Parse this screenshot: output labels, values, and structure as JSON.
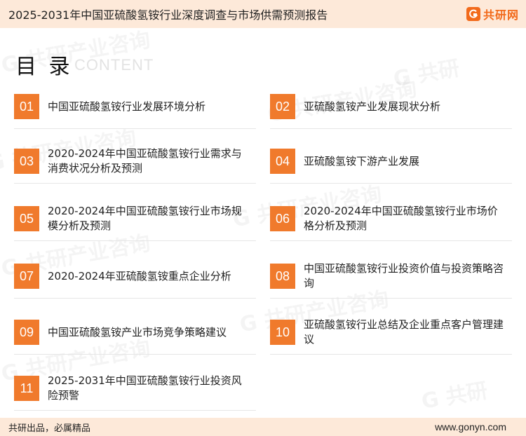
{
  "header": {
    "title": "2025-2031年中国亚硫酸氢铵行业深度调查与市场供需预测报告",
    "logo_text": "共研网"
  },
  "toc": {
    "title": "目 录",
    "subtitle": "CONTENT"
  },
  "items": [
    {
      "num": "01",
      "label": "中国亚硫酸氢铵行业发展环境分析"
    },
    {
      "num": "02",
      "label": "亚硫酸氢铵产业发展现状分析"
    },
    {
      "num": "03",
      "label": "2020-2024年中国亚硫酸氢铵行业需求与消费状况分析及预测"
    },
    {
      "num": "04",
      "label": "亚硫酸氢铵下游产业发展"
    },
    {
      "num": "05",
      "label": "2020-2024年中国亚硫酸氢铵行业市场规模分析及预测"
    },
    {
      "num": "06",
      "label": "2020-2024年中国亚硫酸氢铵行业市场价格分析及预测"
    },
    {
      "num": "07",
      "label": "2020-2024年亚硫酸氢铵重点企业分析"
    },
    {
      "num": "08",
      "label": "中国亚硫酸氢铵行业投资价值与投资策略咨询"
    },
    {
      "num": "09",
      "label": "中国亚硫酸氢铵产业市场竞争策略建议"
    },
    {
      "num": "10",
      "label": "亚硫酸氢铵行业总结及企业重点客户管理建议"
    },
    {
      "num": "11",
      "label": "2025-2031年中国亚硫酸氢铵行业投资风险预警"
    }
  ],
  "footer": {
    "left": "共研出品，必属精品",
    "right": "www.gonyn.com"
  },
  "colors": {
    "accent": "#f07a2c",
    "band": "#fde9d9"
  }
}
